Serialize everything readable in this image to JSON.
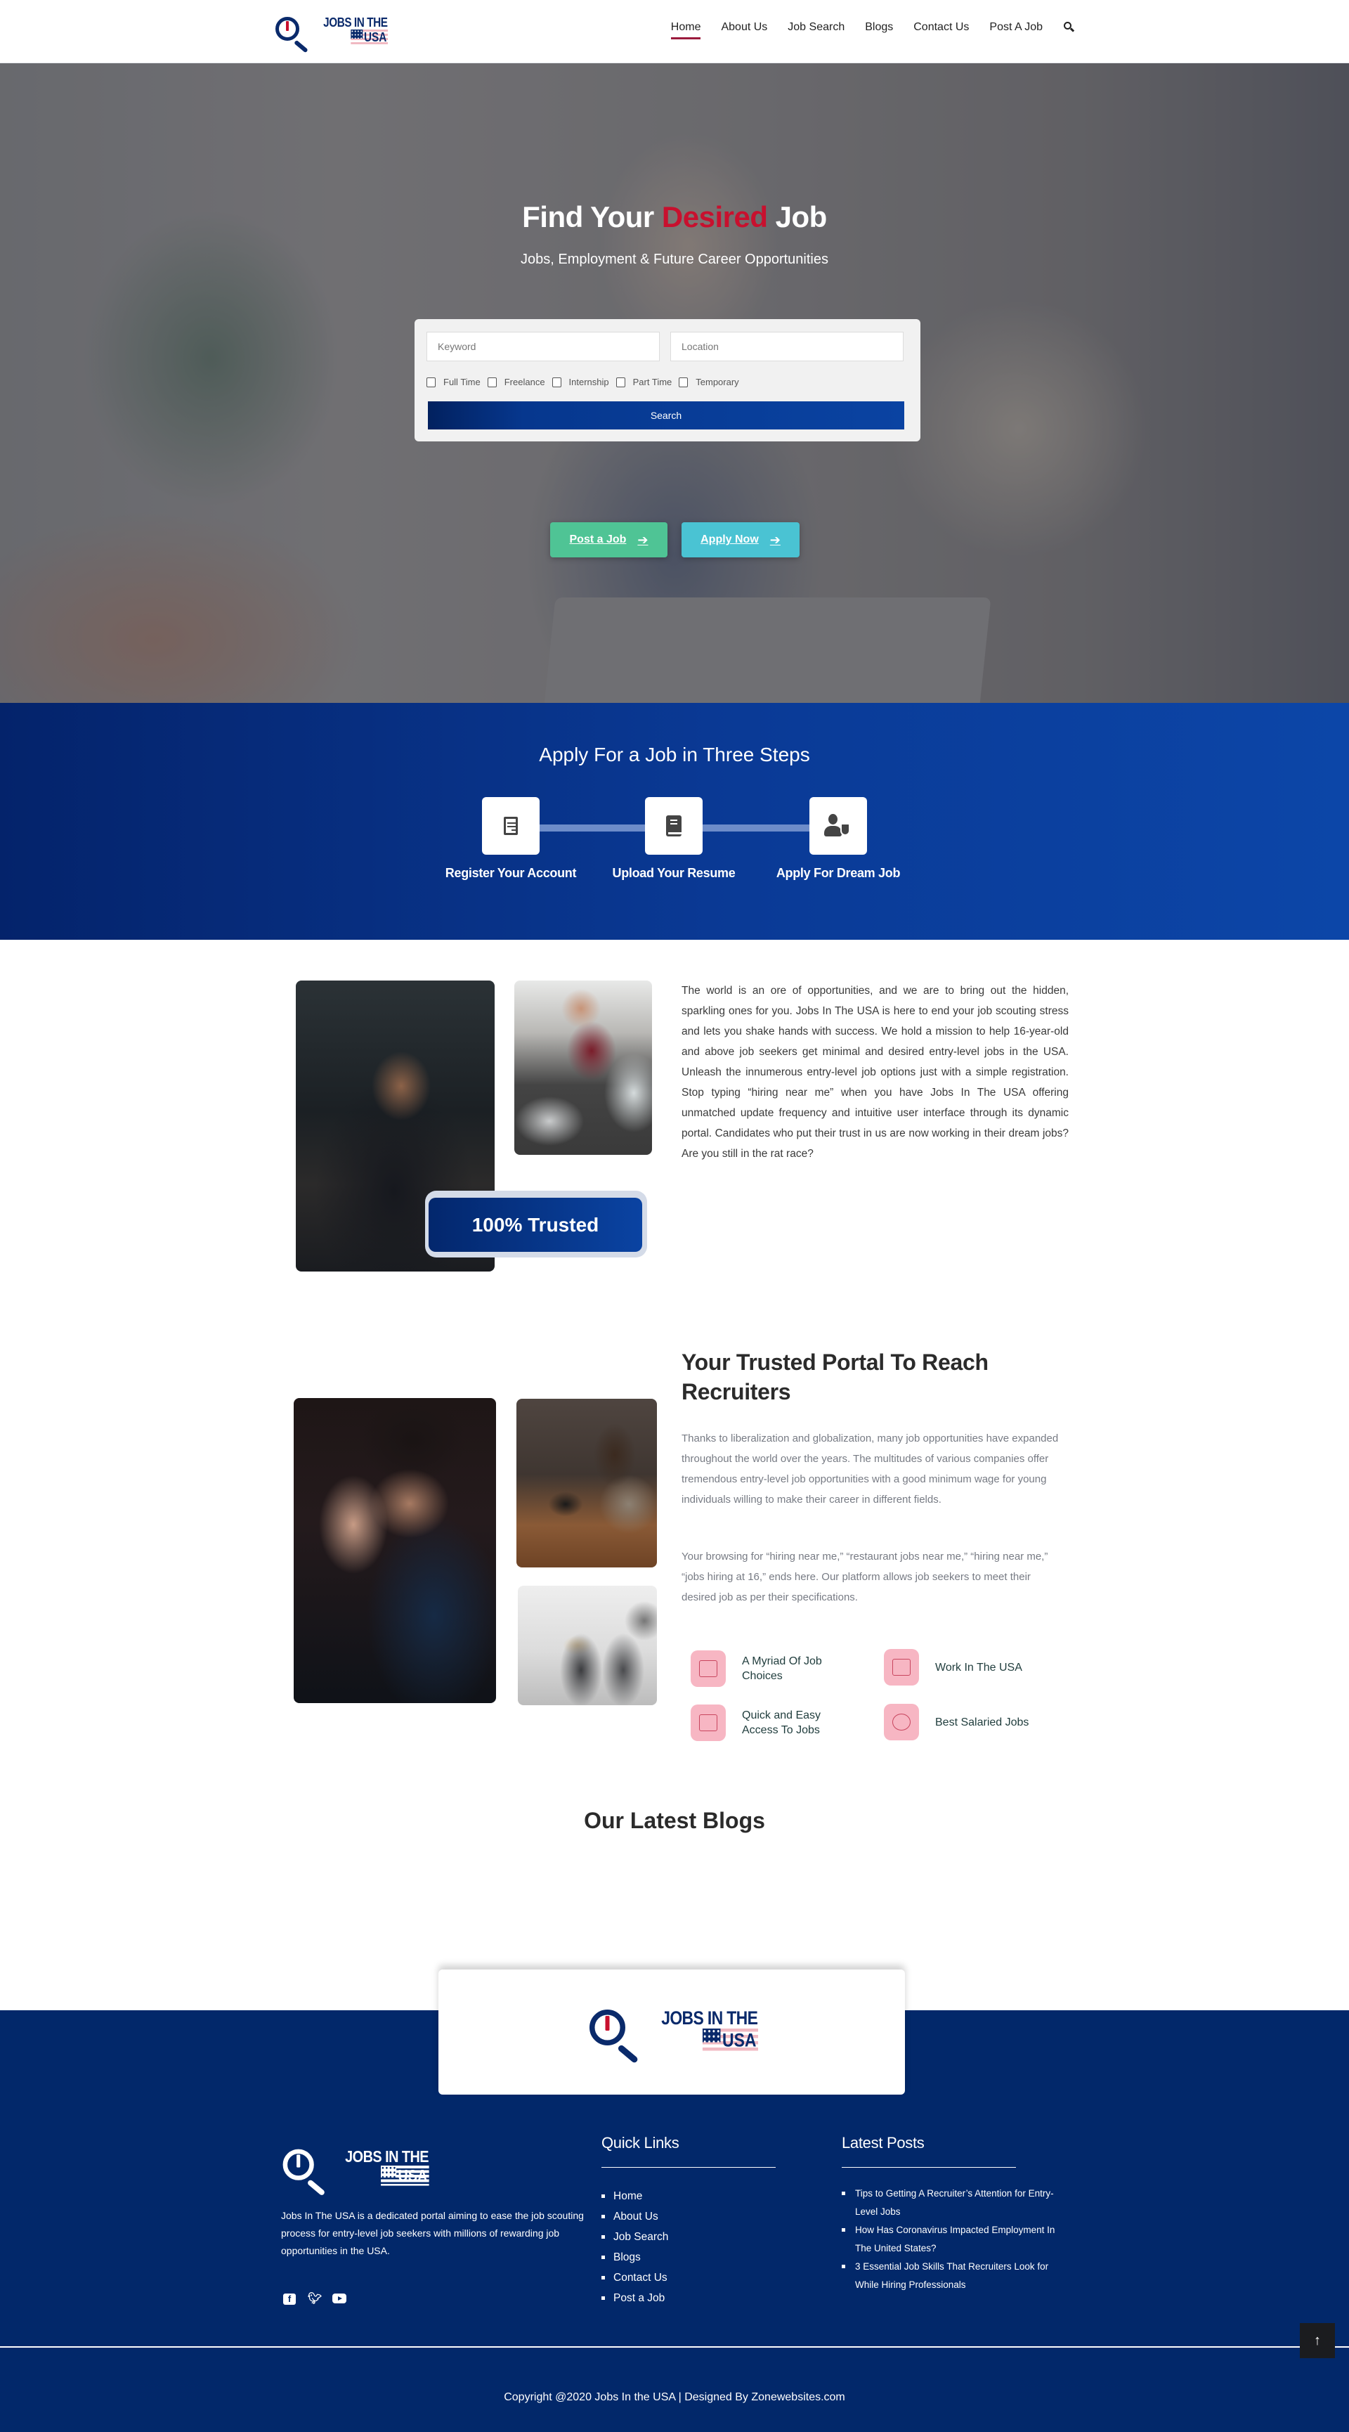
{
  "header": {
    "logo": {
      "line1": "JOBS IN THE",
      "line2": "USA"
    },
    "nav": [
      {
        "label": "Home",
        "active": true
      },
      {
        "label": "About Us"
      },
      {
        "label": "Job Search"
      },
      {
        "label": "Blogs"
      },
      {
        "label": "Contact Us"
      },
      {
        "label": "Post A Job"
      }
    ],
    "search_icon": "search-icon"
  },
  "hero": {
    "title_part1": "Find Your",
    "title_accent": "Desired",
    "title_part2": "Job",
    "subtitle": "Jobs, Employment & Future Career Opportunities",
    "accent_color": "#c8102e",
    "search": {
      "keyword_placeholder": "Keyword",
      "keyword_value": "",
      "location_placeholder": "Location",
      "location_value": "",
      "job_types": [
        {
          "label": "Full Time",
          "checked": false
        },
        {
          "label": "Freelance",
          "checked": false
        },
        {
          "label": "Internship",
          "checked": false
        },
        {
          "label": "Part Time",
          "checked": false
        },
        {
          "label": "Temporary",
          "checked": false
        }
      ],
      "button_label": "Search"
    },
    "cta": {
      "post_label": "Post a Job",
      "post_color": "#4fc495",
      "apply_label": "Apply Now",
      "apply_color": "#4ac3d3",
      "arrow_icon": "arrow-right-icon"
    }
  },
  "steps": {
    "title": "Apply For a Job in Three Steps",
    "items": [
      {
        "label": "Register Your Account",
        "icon": "registration-form-icon"
      },
      {
        "label": "Upload Your Resume",
        "icon": "book-icon"
      },
      {
        "label": "Apply For Dream Job",
        "icon": "user-shield-icon"
      }
    ]
  },
  "about": {
    "badge": "100% Trusted",
    "text": "The world is an ore of opportunities, and we are to bring out the hidden, sparkling ones for you. Jobs In The USA is here to end your job scouting stress and lets you shake hands with success. We hold a mission to help 16-year-old and above job seekers get minimal and desired entry-level jobs in the USA. Unleash the innumerous entry-level job options just with a simple registration. Stop typing “hiring near me” when you have Jobs In The USA offering unmatched update frequency and intuitive user interface through its dynamic portal. Candidates who put their trust in us are now working in their dream jobs? Are you still in the rat race?"
  },
  "portal": {
    "title": "Your Trusted Portal To Reach Recruiters",
    "paragraph1": "Thanks to liberalization and globalization, many job opportunities have expanded throughout the world over the years. The multitudes of various companies offer tremendous entry-level job opportunities with a good minimum wage for young individuals willing to make their career in different fields.",
    "paragraph2": "Your browsing for “hiring near me,” “restaurant jobs near me,” “hiring near me,” “jobs hiring at 16,” ends here. Our platform allows job seekers to meet their desired job as per their specifications.",
    "features": [
      {
        "label": "A Myriad Of Job Choices",
        "icon": "office-building-icon"
      },
      {
        "label": "Work In The USA",
        "icon": "resume-check-icon"
      },
      {
        "label": "Quick and Easy Access To Jobs",
        "icon": "team-icon"
      },
      {
        "label": "Best Salaried Jobs",
        "icon": "money-icon"
      }
    ]
  },
  "blogs": {
    "title": "Our Latest Blogs"
  },
  "footer": {
    "logo": {
      "line1": "JOBS IN THE",
      "line2": "USA"
    },
    "about": "Jobs In The USA is a dedicated portal aiming to ease the job scouting process for entry-level job seekers with millions of rewarding job opportunities in the USA.",
    "socials": [
      "facebook-icon",
      "twitter-icon",
      "youtube-icon"
    ],
    "quick_links_title": "Quick Links",
    "quick_links": [
      "Home",
      "About Us",
      "Job Search",
      "Blogs",
      "Contact Us",
      "Post a Job"
    ],
    "latest_posts_title": "Latest Posts",
    "latest_posts": [
      "Tips to Getting A Recruiter’s Attention for Entry-Level Jobs",
      "How Has Coronavirus Impacted Employment In The United States?",
      "3 Essential Job Skills That Recruiters Look for While Hiring Professionals"
    ],
    "copyright": "Copyright @2020 Jobs In the USA | Designed By Zonewebsites.com",
    "back_to_top_icon": "arrow-up-icon",
    "brand_color": "#02286a"
  }
}
